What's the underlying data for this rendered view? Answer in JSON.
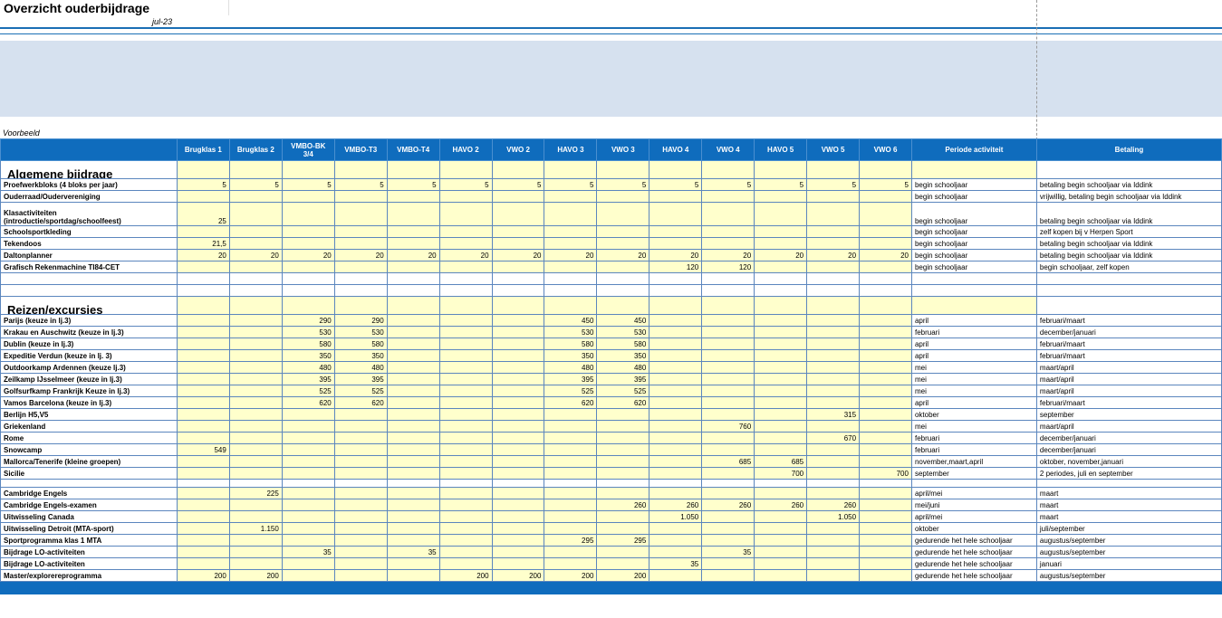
{
  "title": "Overzicht ouderbijdrage",
  "date": "jul-23",
  "example_label": "Voorbeeld",
  "columns": [
    "",
    "Brugklas 1",
    "Brugklas 2",
    "VMBO-BK 3/4",
    "VMBO-T3",
    "VMBO-T4",
    "HAVO 2",
    "VWO 2",
    "HAVO 3",
    "VWO 3",
    "HAVO 4",
    "VWO 4",
    "HAVO 5",
    "VWO 5",
    "VWO 6",
    "Periode activiteit",
    "Betaling"
  ],
  "rows": [
    {
      "type": "section",
      "label": "Algemene bijdrage"
    },
    {
      "type": "data",
      "label": "Proefwerkbloks (4 bloks per jaar)",
      "v": [
        "5",
        "5",
        "5",
        "5",
        "5",
        "5",
        "5",
        "5",
        "5",
        "5",
        "5",
        "5",
        "5",
        "5"
      ],
      "periode": "begin schooljaar",
      "betaling": "betaling begin schooljaar via Iddink"
    },
    {
      "type": "data",
      "label": "Ouderraad/Oudervereniging",
      "v": [
        "",
        "",
        "",
        "",
        "",
        "",
        "",
        "",
        "",
        "",
        "",
        "",
        "",
        ""
      ],
      "periode": "begin schooljaar",
      "betaling": "vrijwillig,  betaling begin schooljaar via Iddink"
    },
    {
      "type": "tall",
      "label": "Klasactiviteiten (introductie/sportdag/schoolfeest)",
      "v": [
        "25",
        "",
        "",
        "",
        "",
        "",
        "",
        "",
        "",
        "",
        "",
        "",
        "",
        ""
      ],
      "periode": "begin schooljaar",
      "betaling": "betaling begin schooljaar via Iddink"
    },
    {
      "type": "data",
      "label": "Schoolsportkleding",
      "v": [
        "",
        "",
        "",
        "",
        "",
        "",
        "",
        "",
        "",
        "",
        "",
        "",
        "",
        ""
      ],
      "periode": "begin schooljaar",
      "betaling": "zelf kopen bij v Herpen Sport"
    },
    {
      "type": "data",
      "label": "Tekendoos",
      "v": [
        "21,5",
        "",
        "",
        "",
        "",
        "",
        "",
        "",
        "",
        "",
        "",
        "",
        "",
        ""
      ],
      "periode": "begin schooljaar",
      "betaling": "betaling begin schooljaar via Iddink"
    },
    {
      "type": "data",
      "label": "Daltonplanner",
      "v": [
        "20",
        "20",
        "20",
        "20",
        "20",
        "20",
        "20",
        "20",
        "20",
        "20",
        "20",
        "20",
        "20",
        "20"
      ],
      "periode": "begin schooljaar",
      "betaling": "betaling begin schooljaar via Iddink"
    },
    {
      "type": "data",
      "label": "Grafisch Rekenmachine TI84-CET",
      "v": [
        "",
        "",
        "",
        "",
        "",
        "",
        "",
        "",
        "",
        "120",
        "120",
        "",
        "",
        ""
      ],
      "periode": " begin schooljaar",
      "betaling": "begin schooljaar, zelf kopen"
    },
    {
      "type": "blank"
    },
    {
      "type": "blank"
    },
    {
      "type": "section",
      "label": "Reizen/excursies"
    },
    {
      "type": "data",
      "label": "Parijs (keuze in lj.3)",
      "v": [
        "",
        "",
        "290",
        "290",
        "",
        "",
        "",
        "450",
        "450",
        "",
        "",
        "",
        "",
        ""
      ],
      "periode": "april",
      "betaling": "februari/maart"
    },
    {
      "type": "data",
      "label": "Krakau en Auschwitz (keuze in lj.3)",
      "v": [
        "",
        "",
        "530",
        "530",
        "",
        "",
        "",
        "530",
        "530",
        "",
        "",
        "",
        "",
        ""
      ],
      "periode": "februari",
      "betaling": "december/januari"
    },
    {
      "type": "data",
      "label": "Dublin (keuze in lj.3)",
      "v": [
        "",
        "",
        "580",
        "580",
        "",
        "",
        "",
        "580",
        "580",
        "",
        "",
        "",
        "",
        ""
      ],
      "periode": "april",
      "betaling": "februari/maart"
    },
    {
      "type": "data",
      "label": "Expeditie Verdun (keuze in lj. 3)",
      "v": [
        "",
        "",
        "350",
        "350",
        "",
        "",
        "",
        "350",
        "350",
        "",
        "",
        "",
        "",
        ""
      ],
      "periode": "april",
      "betaling": "februari/maart"
    },
    {
      "type": "data",
      "label": "Outdoorkamp Ardennen (keuze lj.3)",
      "v": [
        "",
        "",
        "480",
        "480",
        "",
        "",
        "",
        "480",
        "480",
        "",
        "",
        "",
        "",
        ""
      ],
      "periode": "mei",
      "betaling": "maart/april"
    },
    {
      "type": "data",
      "label": "Zeilkamp IJsselmeer (keuze in lj.3)",
      "v": [
        "",
        "",
        "395",
        "395",
        "",
        "",
        "",
        "395",
        "395",
        "",
        "",
        "",
        "",
        ""
      ],
      "periode": "mei",
      "betaling": "maart/april"
    },
    {
      "type": "data",
      "label": "Golfsurfkamp Frankrijk Keuze in lj.3)",
      "v": [
        "",
        "",
        "525",
        "525",
        "",
        "",
        "",
        "525",
        "525",
        "",
        "",
        "",
        "",
        ""
      ],
      "periode": "mei",
      "betaling": "maart/april"
    },
    {
      "type": "data",
      "label": "Vamos Barcelona (keuze in lj.3)",
      "v": [
        "",
        "",
        "620",
        "620",
        "",
        "",
        "",
        "620",
        "620",
        "",
        "",
        "",
        "",
        ""
      ],
      "periode": "april",
      "betaling": "februari/maart"
    },
    {
      "type": "data",
      "label": "Berlijn H5,V5",
      "v": [
        "",
        "",
        "",
        "",
        "",
        "",
        "",
        "",
        "",
        "",
        "",
        "",
        "315",
        ""
      ],
      "periode": "oktober",
      "betaling": "september"
    },
    {
      "type": "data",
      "label": "Griekenland",
      "v": [
        "",
        "",
        "",
        "",
        "",
        "",
        "",
        "",
        "",
        "",
        "760",
        "",
        "",
        ""
      ],
      "periode": "mei",
      "betaling": "maart/april"
    },
    {
      "type": "data",
      "label": "Rome",
      "v": [
        "",
        "",
        "",
        "",
        "",
        "",
        "",
        "",
        "",
        "",
        "",
        "",
        "670",
        ""
      ],
      "periode": "februari",
      "betaling": "december/januari"
    },
    {
      "type": "data",
      "label": "Snowcamp",
      "v": [
        "549",
        "",
        "",
        "",
        "",
        "",
        "",
        "",
        "",
        "",
        "",
        "",
        "",
        ""
      ],
      "periode": "februari",
      "betaling": "december/januari"
    },
    {
      "type": "data",
      "label": "Mallorca/Tenerife (kleine groepen)",
      "v": [
        "",
        "",
        "",
        "",
        "",
        "",
        "",
        "",
        "",
        "",
        "685",
        "685",
        "",
        ""
      ],
      "periode": "november,maart,april",
      "betaling": "oktober, november,januari"
    },
    {
      "type": "data",
      "label": "Sicilie",
      "v": [
        "",
        "",
        "",
        "",
        "",
        "",
        "",
        "",
        "",
        "",
        "",
        "700",
        "",
        "700"
      ],
      "periode": "september",
      "betaling": "2 periodes, juli en september"
    },
    {
      "type": "gap"
    },
    {
      "type": "data",
      "label": "Cambridge Engels",
      "v": [
        "",
        "225",
        "",
        "",
        "",
        "",
        "",
        "",
        "",
        "",
        "",
        "",
        "",
        ""
      ],
      "periode": "april/mei",
      "betaling": "maart"
    },
    {
      "type": "data",
      "label": "Cambridge Engels-examen",
      "v": [
        "",
        "",
        "",
        "",
        "",
        "",
        "",
        "",
        "260",
        "260",
        "260",
        "260",
        "260",
        ""
      ],
      "periode": "mei/juni",
      "betaling": "maart"
    },
    {
      "type": "data",
      "label": "Uitwisseling Canada",
      "v": [
        "",
        "",
        "",
        "",
        "",
        "",
        "",
        "",
        "",
        "1.050",
        "",
        "",
        "1.050",
        ""
      ],
      "periode": "april/mei",
      "betaling": "maart"
    },
    {
      "type": "data",
      "label": "Uitwisseling Detroit (MTA-sport)",
      "v": [
        "",
        "1.150",
        "",
        "",
        "",
        "",
        "",
        "",
        "",
        "",
        "",
        "",
        "",
        ""
      ],
      "periode": "oktober",
      "betaling": "juli/september"
    },
    {
      "type": "data",
      "label": "Sportprogramma klas 1 MTA",
      "v": [
        "",
        "",
        "",
        "",
        "",
        "",
        "",
        "295",
        "295",
        "",
        "",
        "",
        "",
        ""
      ],
      "periode": "gedurende het hele schooljaar",
      "betaling": "augustus/september"
    },
    {
      "type": "data",
      "label": "Bijdrage LO-activiteiten",
      "v": [
        "",
        "",
        "35",
        "",
        "35",
        "",
        "",
        "",
        "",
        "",
        "35",
        "",
        "",
        ""
      ],
      "periode": "gedurende het hele schooljaar",
      "betaling": "augustus/september"
    },
    {
      "type": "data",
      "label": "Bijdrage LO-activiteiten",
      "v": [
        "",
        "",
        "",
        "",
        "",
        "",
        "",
        "",
        "",
        "35",
        "",
        "",
        "",
        ""
      ],
      "periode": "gedurende het hele schooljaar",
      "betaling": "januari"
    },
    {
      "type": "data",
      "label": "Master/explorereprogramma",
      "v": [
        "200",
        "200",
        "",
        "",
        "",
        "200",
        "200",
        "200",
        "200",
        "",
        "",
        "",
        "",
        ""
      ],
      "periode": "gedurende het hele schooljaar",
      "betaling": "augustus/september"
    }
  ]
}
